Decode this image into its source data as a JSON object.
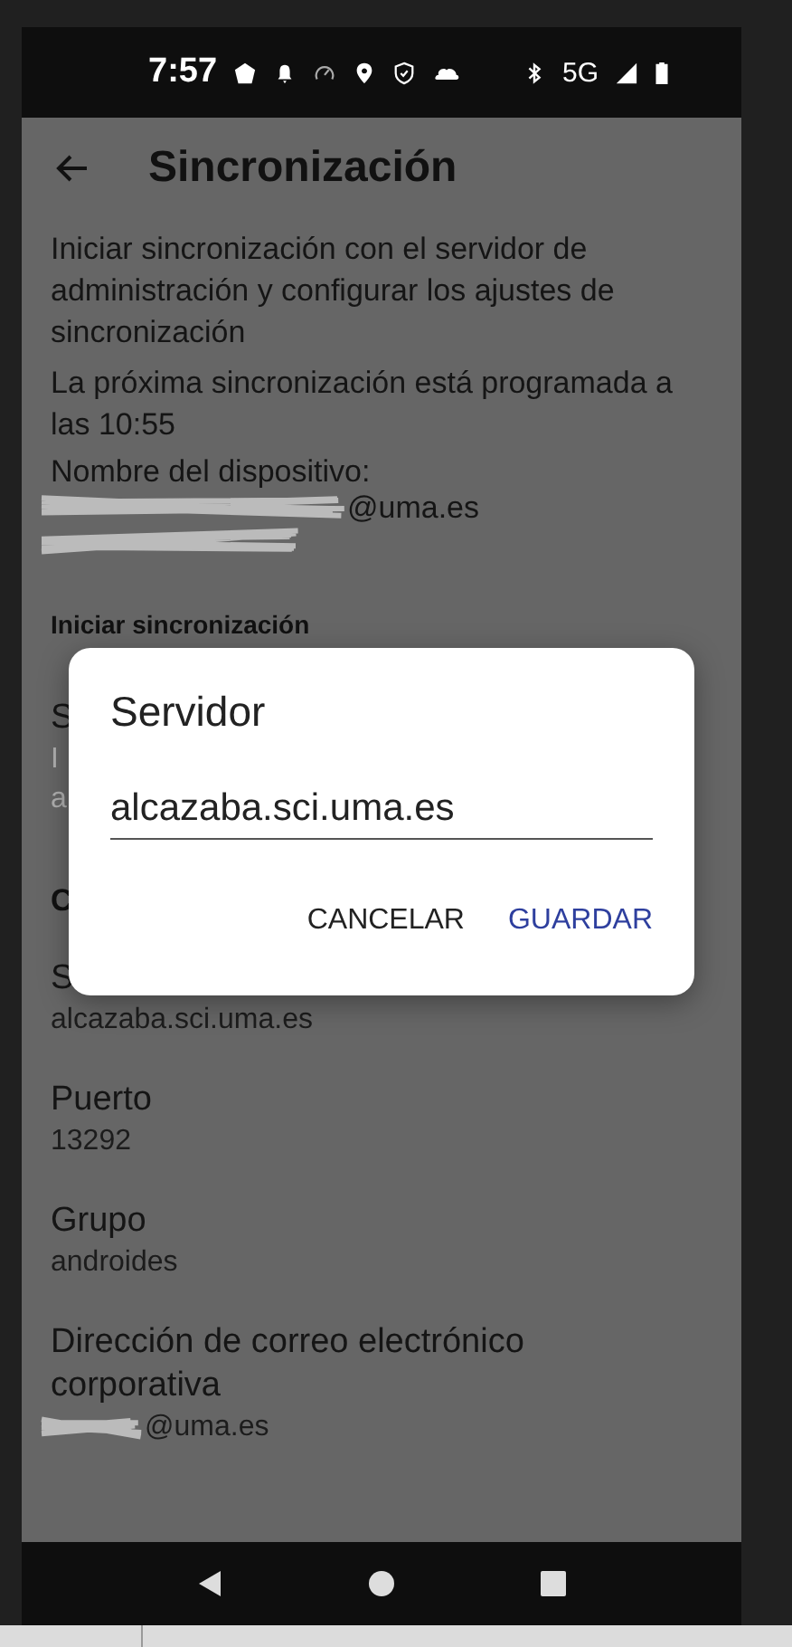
{
  "status_bar": {
    "time": "7:57",
    "network": "5G"
  },
  "app_bar": {
    "title": "Sincronización"
  },
  "intro": [
    {
      "text": "Iniciar sincronización con el servidor de administración y configurar los ajustes de sincronización"
    },
    {
      "text": "La próxima sincronización está programada a las 10:55"
    }
  ],
  "device": {
    "label": "Nombre del dispositivo:",
    "value_suffix": "@uma.es"
  },
  "sections": [
    {
      "title": "Iniciar sincronización",
      "items": [
        {
          "title": "S",
          "summary": [
            "I",
            "a"
          ]
        }
      ]
    },
    {
      "title": "C",
      "items": [
        {
          "title": "S",
          "summary": [
            "alcazaba.sci.uma.es"
          ]
        },
        {
          "title": "Puerto",
          "summary": [
            "13292"
          ]
        },
        {
          "title": "Grupo",
          "summary": [
            "androides"
          ]
        },
        {
          "title": "Dirección de correo electrónico corporativa",
          "summary": [
            "@uma.es"
          ],
          "redacted": true
        }
      ]
    }
  ],
  "dialog": {
    "title": "Servidor",
    "value": "alcazaba.sci.uma.es",
    "buttons": [
      {
        "label": "CANCELAR",
        "primary": false
      },
      {
        "label": "GUARDAR",
        "primary": true
      }
    ]
  }
}
